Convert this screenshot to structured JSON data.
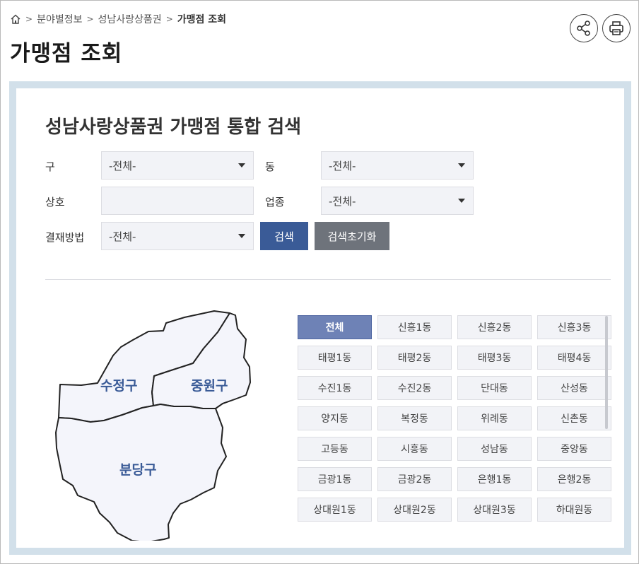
{
  "breadcrumb": {
    "items": [
      "분야별정보",
      "성남사랑상품권"
    ],
    "current": "가맹점 조회",
    "separator": ">"
  },
  "page_title": "가맹점 조회",
  "icons": {
    "home": "home-icon",
    "share": "share-icon",
    "print": "print-icon"
  },
  "search": {
    "title": "성남사랑상품권 가맹점 통합 검색",
    "labels": {
      "gu": "구",
      "dong": "동",
      "name": "상호",
      "category": "업종",
      "payment": "결재방법"
    },
    "values": {
      "gu": "-전체-",
      "dong": "-전체-",
      "name": "",
      "category": "-전체-",
      "payment": "-전체-"
    },
    "search_button": "검색",
    "reset_button": "검색초기화"
  },
  "map": {
    "regions": [
      "수정구",
      "중원구",
      "분당구"
    ]
  },
  "dong_list": [
    "전체",
    "신흥1동",
    "신흥2동",
    "신흥3동",
    "태평1동",
    "태평2동",
    "태평3동",
    "태평4동",
    "수진1동",
    "수진2동",
    "단대동",
    "산성동",
    "양지동",
    "복정동",
    "위례동",
    "신촌동",
    "고등동",
    "시흥동",
    "성남동",
    "중앙동",
    "금광1동",
    "금광2동",
    "은행1동",
    "은행2동",
    "상대원1동",
    "상대원2동",
    "상대원3동",
    "하대원동"
  ],
  "selected_dong": "전체",
  "colors": {
    "accent": "#3a5b97",
    "active_dong": "#6e82b6",
    "reset": "#6e737b",
    "frame": "#d2e0ea"
  }
}
